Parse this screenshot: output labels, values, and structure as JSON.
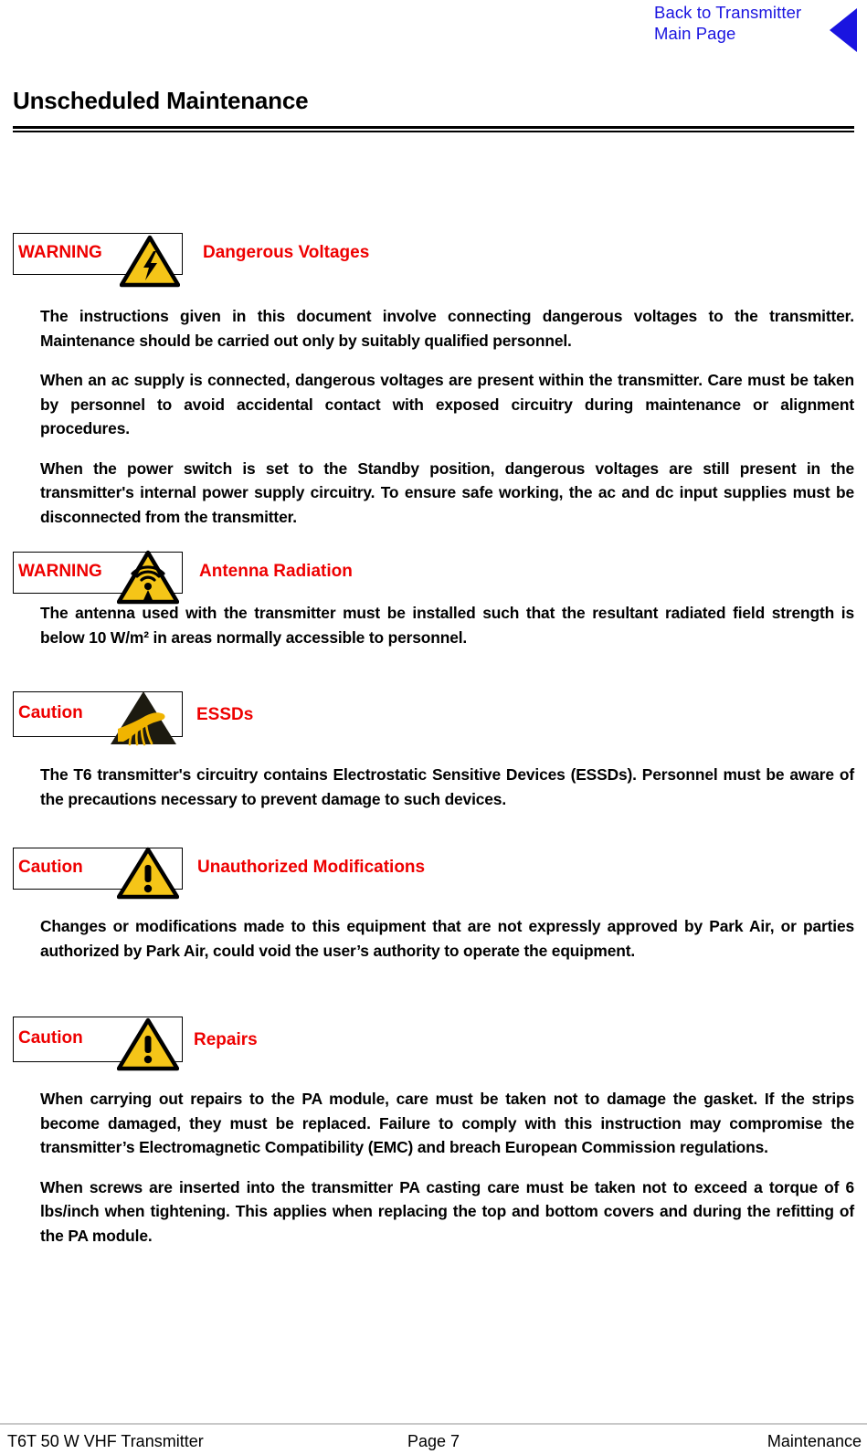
{
  "nav": {
    "link_line1": "Back to Transmitter",
    "link_line2": "Main Page",
    "arrow_icon": "back-triangle-icon",
    "link_color": "#1a14e0"
  },
  "heading": {
    "title": "Unscheduled Maintenance"
  },
  "colors": {
    "alert_red": "#ee0000",
    "hazard_yellow": "#f5c518",
    "link_blue": "#1a14e0",
    "rule_gray": "#c8c8c8"
  },
  "notices": [
    {
      "label": "WARNING",
      "title": "Dangerous Voltages",
      "icon": "high-voltage-triangle-icon",
      "paragraphs": [
        "The instructions given in this document involve connecting dangerous voltages to the transmitter. Maintenance should be carried out only by suitably qualified personnel.",
        "When an ac supply is connected, dangerous voltages are present within the transmitter. Care must be taken by personnel to avoid accidental contact with exposed circuitry during maintenance or alignment procedures.",
        "When the power switch is set to the Standby position, dangerous voltages are still present in the transmitter's internal power supply circuitry. To ensure safe working, the ac and dc input supplies must be disconnected from the transmitter."
      ]
    },
    {
      "label": "WARNING",
      "title": "Antenna Radiation",
      "icon": "antenna-radiation-triangle-icon",
      "paragraphs": [
        "The antenna used with the transmitter must be installed such that the resultant radiated field strength is below 10 W/m² in areas normally accessible to personnel."
      ]
    },
    {
      "label": "Caution",
      "title": "ESSDs",
      "icon": "esd-hand-triangle-icon",
      "paragraphs": [
        "The T6 transmitter's circuitry contains Electrostatic Sensitive Devices (ESSDs). Personnel must be aware of the precautions necessary to prevent damage to such devices."
      ]
    },
    {
      "label": "Caution",
      "title": "Unauthorized Modifications",
      "icon": "exclamation-triangle-icon",
      "paragraphs": [
        "Changes or modifications made to this equipment that are not expressly approved by Park Air, or parties authorized by Park Air, could void the user’s authority to operate the equipment."
      ]
    },
    {
      "label": "Caution",
      "title": "Repairs",
      "icon": "exclamation-triangle-icon",
      "paragraphs": [
        "When carrying out repairs to the PA module, care must be taken not to damage the gasket. If the strips become damaged, they must be replaced. Failure to comply with this instruction may compromise the transmitter’s Electromagnetic Compatibility (EMC) and breach European Commission regulations.",
        "When screws are inserted into the transmitter PA casting care must be taken not to exceed a torque of 6 lbs/inch when tightening. This applies when replacing the top and bottom covers and during the refitting of the PA module."
      ]
    }
  ],
  "footer": {
    "left": "T6T 50 W VHF Transmitter",
    "center": "Page 7",
    "right": "Maintenance"
  }
}
